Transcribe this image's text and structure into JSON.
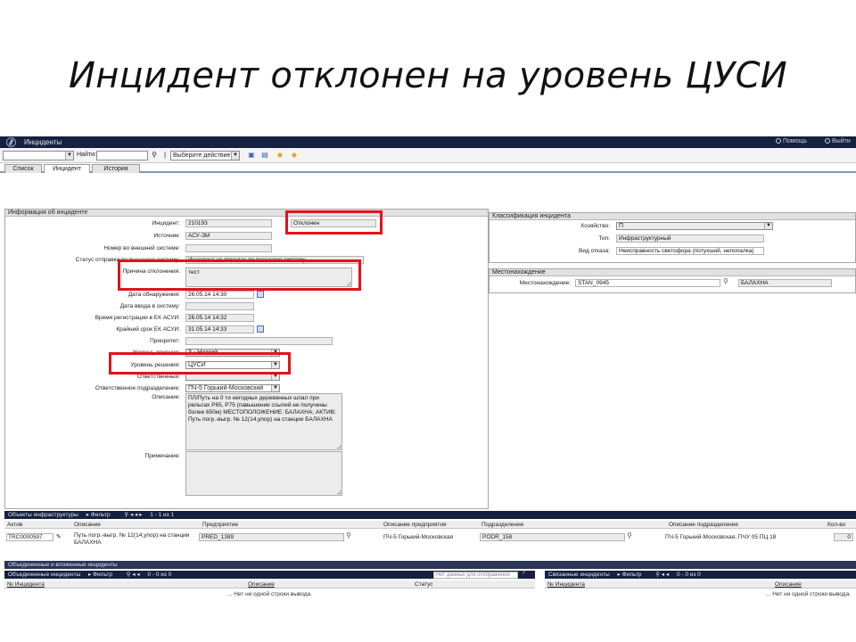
{
  "slide_title": "Инцидент отклонен на уровень ЦУСИ",
  "header": {
    "app_title": "Инциденты",
    "help": "Помощь",
    "exit": "Выйти"
  },
  "toolbar": {
    "find_label": "Найти:",
    "find_value": "",
    "actions_value": "Выберите действие",
    "first_select_value": ""
  },
  "tabs": [
    "Список",
    "Инцидент",
    "История"
  ],
  "incident_panel": {
    "title": "Информация об инциденте",
    "fields": {
      "incident_label": "Инцидент:",
      "incident_value": "210193",
      "status_value": "Отклонен",
      "source_label": "Источник:",
      "source_value": "АСУ-ЗМ",
      "ext_number_label": "Номер во внешней системе:",
      "ext_number_value": "",
      "send_status_label": "Статус отправки во внешнюю систему:",
      "send_status_value": "Инцидент не передан во внешнюю систему",
      "reject_reason_label": "Причина отклонения:",
      "reject_reason_value": "тест",
      "detect_date_label": "Дата обнаружения:",
      "detect_date_value": "26.05.14 14:30",
      "entry_date_label": "Дата ввода в систему:",
      "entry_date_value": "",
      "reg_time_label": "Время регистрации в ЕК АСУИ:",
      "reg_time_value": "26.05.14 14:32",
      "deadline_label": "Крайний срок ЕК АСУИ:",
      "deadline_value": "31.05.14 14:33",
      "priority_label": "Приоритет:",
      "priority_value": "",
      "impact_label": "Уровень влияния:",
      "impact_value": "3 - Низкий",
      "resolve_level_label": "Уровень решения:",
      "resolve_level_value": "ЦУСИ",
      "responsible_label": "Ответственный:",
      "responsible_value": "",
      "resp_unit_label": "Ответственное подразделение:",
      "resp_unit_value": "ПЧ-5 Горький-Московский",
      "description_label": "Описание:",
      "description_value": "ПЛ/Путь на 0 ти негодных деревянных шпал при рельсах Р65, Р75 (павышение ссыпей не получены более 650м) МЕСТОПОЛОЖЕНИЕ: БАЛАХНА; АКТИВ: Путь погр.-выгр. № 12(14,упор) на станции БАЛАХНА",
      "note_label": "Примечание:",
      "note_value": ""
    }
  },
  "classification_panel": {
    "title": "Классификация инцидента",
    "economy_label": "Хозяйство:",
    "economy_value": "П",
    "type_label": "Тип:",
    "type_value": "Инфраструктурный",
    "failure_label": "Вид отказа:",
    "failure_value": "Неисправность светофора (потухший, непопалка)"
  },
  "location_panel": {
    "title": "Местонахождение",
    "location_label": "Местонахождение:",
    "station_code": "STAN_0945",
    "station_name": "БАЛАХНА"
  },
  "infra_grid": {
    "bar_title": "Объекты инфраструктуры",
    "bar_filter": "Фильтр",
    "bar_pages": "1 - 1 из 1",
    "headers": [
      "Актив",
      "Описание",
      "Предприятие",
      "Описание предприятия",
      "Подразделение",
      "Описание подразделения",
      "Кол-во"
    ],
    "row": {
      "asset": "TRC0000597",
      "description": "Путь погр.-выгр. № 12(14,упор) на станции БАЛАХНА",
      "enterprise": "PRED_1389",
      "enterprise_desc": "ПЧ-5 Горький-Московская",
      "unit": "PODR_158",
      "unit_desc": "ПЧ-5 Горький-Московская, ПЧУ 05 ПЦ 18",
      "count": "0"
    }
  },
  "merged_bar": "Объединенные и вложенные инциденты",
  "merged_grid": {
    "bar_title": "Объединенные инциденты",
    "bar_filter": "Фильтр",
    "bar_pages": "0 - 0 из 0",
    "bar_search": "Нет данных для отображения",
    "headers": [
      "№ Инцидента",
      "Описание",
      "Статус"
    ],
    "empty": "... Нет ни одной строки вывода."
  },
  "linked_grid": {
    "bar_title": "Связанные инциденты",
    "bar_filter": "Фильтр",
    "bar_pages": "0 - 0 из 0",
    "headers": [
      "№ Инцидента",
      "Описание"
    ],
    "empty": "... Нет ни одной строки вывода."
  }
}
